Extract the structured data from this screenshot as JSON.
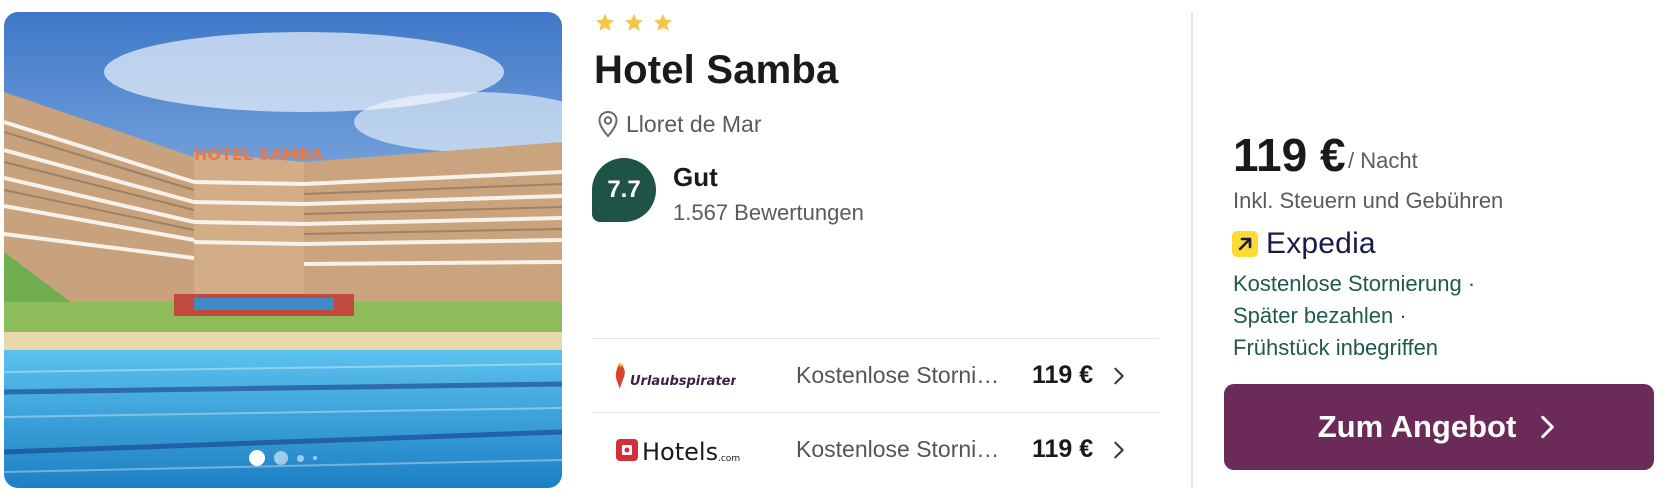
{
  "hotel": {
    "stars": 3,
    "star_color": "#f4c64c",
    "name": "Hotel Samba",
    "sign_text": "HOTEL SAMBA",
    "location": "Lloret de Mar",
    "location_icon": "map-pin-icon",
    "score": "7.7",
    "score_color": "#1f5348",
    "rating_label": "Gut",
    "reviews": "1.567 Bewertungen"
  },
  "gallery": {
    "total_dots": 4,
    "active_index": 0
  },
  "offers": [
    {
      "provider": "Urlaubspiraten",
      "description": "Kostenlose Storni…",
      "price": "119 €",
      "icon": "chevron-right-icon"
    },
    {
      "provider": "Hotels.com",
      "description": "Kostenlose Storni…",
      "price": "119 €",
      "icon": "chevron-right-icon"
    }
  ],
  "main_offer": {
    "price": "119 €",
    "per_night": "/ Nacht",
    "taxes_note": "Inkl. Steuern und Gebühren",
    "provider": "Expedia",
    "perks": [
      "Kostenlose Stornierung ·",
      "Später bezahlen ·",
      "Frühstück inbegriffen"
    ],
    "perk_color": "#1f5a4a",
    "cta_label": "Zum Angebot",
    "cta_color": "#6b2a58"
  },
  "hotels_com_logo": {
    "main": "Hotels",
    "suffix": ".com"
  }
}
